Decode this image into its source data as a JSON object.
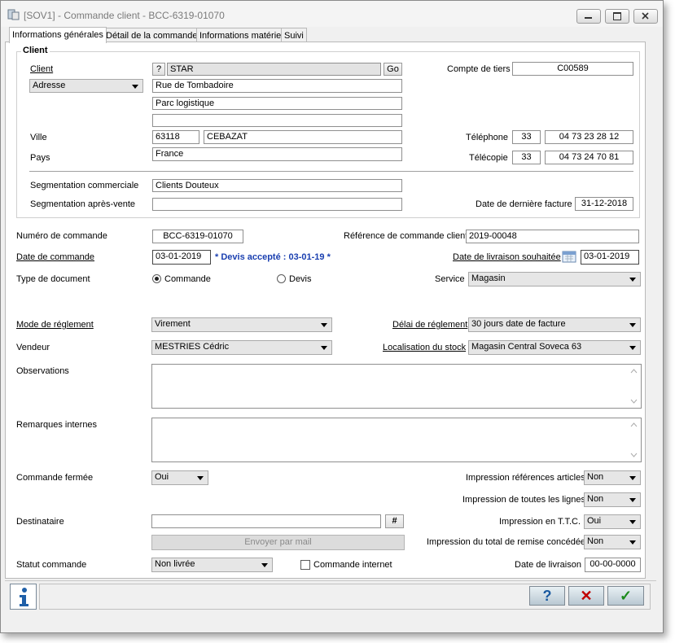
{
  "window": {
    "title": "[SOV1] - Commande client - BCC-6319-01070"
  },
  "tabs": [
    "Informations générales",
    "Détail de la commande",
    "Informations matériel",
    "Suivi"
  ],
  "client_group": {
    "title": "Client",
    "client_label": "Client",
    "help_btn": "?",
    "client_name": "STAR",
    "go_btn": "Go",
    "address_select": "Adresse",
    "address_lines": [
      "Rue de Tombadoire",
      "Parc logistique",
      ""
    ],
    "ville_label": "Ville",
    "postal_code": "63118",
    "city": "CEBAZAT",
    "pays_label": "Pays",
    "country": "France",
    "compte_label": "Compte de tiers",
    "compte_value": "C00589",
    "tel_label": "Téléphone",
    "tel_prefix": "33",
    "tel_number": "04 73 23 28 12",
    "fax_label": "Télécopie",
    "fax_prefix": "33",
    "fax_number": "04 73 24 70 81",
    "seg_comm_label": "Segmentation commerciale",
    "seg_comm_value": "Clients Douteux",
    "seg_apv_label": "Segmentation après-vente",
    "seg_apv_value": "",
    "last_invoice_label": "Date de dernière facture",
    "last_invoice_value": "31-12-2018"
  },
  "order": {
    "num_label": "Numéro de commande",
    "num_value": "BCC-6319-01070",
    "ref_label": "Référence de commande client",
    "ref_value": "2019-00048",
    "date_label": "Date de commande",
    "date_value": "03-01-2019",
    "devis_note": "* Devis accepté : 03-01-19 *",
    "delivery_wish_label": "Date de livraison souhaitée",
    "delivery_wish_value": "03-01-2019",
    "doc_type_label": "Type de document",
    "doc_type_commande": "Commande",
    "doc_type_devis": "Devis",
    "service_label": "Service",
    "service_value": "Magasin",
    "payment_mode_label": "Mode de réglement",
    "payment_mode_value": "Virement",
    "payment_delay_label": "Délai de réglement",
    "payment_delay_value": "30 jours date de facture",
    "seller_label": "Vendeur",
    "seller_value": "MESTRIES Cédric",
    "stock_label": "Localisation du stock",
    "stock_value": "Magasin Central Soveca 63",
    "observations_label": "Observations",
    "remarks_label": "Remarques internes",
    "closed_label": "Commande fermée",
    "closed_value": "Oui",
    "print_refs_label": "Impression références articles",
    "print_refs_value": "Non",
    "print_lines_label": "Impression de toutes les lignes",
    "print_lines_value": "Non",
    "recipient_label": "Destinataire",
    "recipient_value": "",
    "hash_btn": "#",
    "print_ttc_label": "Impression en T.T.C.",
    "print_ttc_value": "Oui",
    "send_mail_btn": "Envoyer par mail",
    "print_discount_label": "Impression du total de remise concédée",
    "print_discount_value": "Non",
    "status_label": "Statut commande",
    "status_value": "Non livrée",
    "internet_label": "Commande internet",
    "delivery_date_label": "Date de livraison",
    "delivery_date_value": "00-00-0000"
  },
  "toolbar": {
    "help": "?",
    "cancel": "✕",
    "ok": "✓"
  },
  "colors": {
    "devis_note": "#1a3fb0",
    "cancel": "#c00000",
    "ok": "#1a8a1a",
    "help": "#1a5aa0"
  }
}
